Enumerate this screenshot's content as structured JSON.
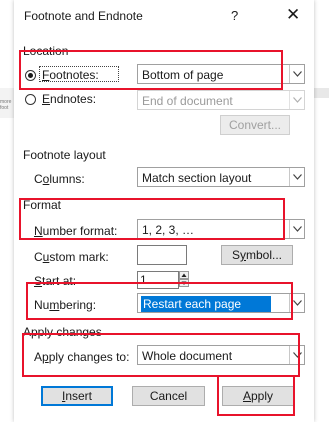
{
  "dialog": {
    "title": "Footnote and Endnote",
    "help_glyph": "?",
    "close_glyph": "✕"
  },
  "background": {
    "text_1": "more",
    "text_2": "foot"
  },
  "location": {
    "heading": "Location",
    "footnotes": {
      "mnemonic": "F",
      "rest": "ootnotes:",
      "value": "Bottom of page",
      "checked": true
    },
    "endnotes": {
      "mnemonic": "E",
      "rest": "ndnotes:",
      "value": "End of document",
      "checked": false
    },
    "convert_label": "Convert..."
  },
  "layout": {
    "heading": "Footnote layout",
    "columns_pre": "C",
    "columns_mnemonic": "o",
    "columns_post": "lumns:",
    "columns_value": "Match section layout"
  },
  "format": {
    "heading": "Format",
    "number_format_mnemonic": "N",
    "number_format_rest": "umber format:",
    "number_format_value": "1, 2, 3, …",
    "custom_mark_pre": "C",
    "custom_mark_mnemonic": "u",
    "custom_mark_post": "stom mark:",
    "symbol_pre": "S",
    "symbol_mnemonic": "y",
    "symbol_post": "mbol...",
    "start_at_pre": "",
    "start_at_mnemonic": "S",
    "start_at_post": "tart at:",
    "start_at_value": "1",
    "numbering_pre": "Nu",
    "numbering_mnemonic": "m",
    "numbering_post": "bering:",
    "numbering_value": "Restart each page"
  },
  "apply": {
    "heading": "Apply changes",
    "apply_to_pre": "A",
    "apply_to_mnemonic": "p",
    "apply_to_post": "ply changes to:",
    "apply_to_value": "Whole document"
  },
  "buttons": {
    "insert_mnemonic": "I",
    "insert_rest": "nsert",
    "cancel": "Cancel",
    "apply_mnemonic": "A",
    "apply_rest": "pply"
  },
  "colors": {
    "annotation_red": "#e8132b",
    "selection_blue": "#0078d7"
  }
}
